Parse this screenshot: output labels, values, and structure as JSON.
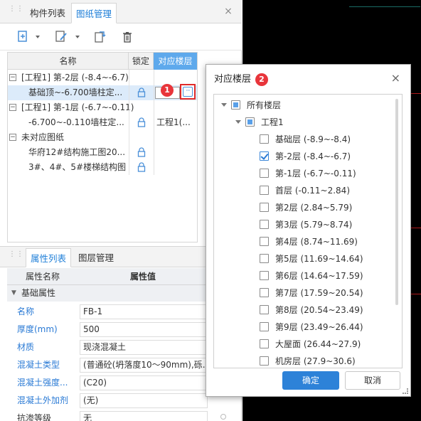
{
  "left_panel": {
    "tabs": [
      {
        "label": "构件列表",
        "active": false
      },
      {
        "label": "图纸管理",
        "active": true
      }
    ],
    "grid": {
      "columns": {
        "name": "名称",
        "lock": "锁定",
        "floor": "对应楼层"
      },
      "rows": [
        {
          "type": "group",
          "expand": "−",
          "name": "[工程1] 第-2层 (-8.4~-6.7)"
        },
        {
          "type": "item",
          "name": "基础顶~-6.700墙柱定...",
          "floor": "",
          "selected": true
        },
        {
          "type": "group",
          "expand": "−",
          "name": "[工程1] 第-1层 (-6.7~-0.11)"
        },
        {
          "type": "item",
          "name": "-6.700~-0.110墙柱定...",
          "floor": "工程1(..."
        },
        {
          "type": "group",
          "expand": "−",
          "name": "未对应图纸"
        },
        {
          "type": "item",
          "name": "华府12#结构施工图20...",
          "floor": ""
        },
        {
          "type": "item",
          "name": "3#、4#、5#楼梯结构图",
          "floor": ""
        }
      ]
    },
    "badge1": "1",
    "more_button_label": "···"
  },
  "properties": {
    "tabs": [
      {
        "label": "属性列表",
        "active": true
      },
      {
        "label": "图层管理",
        "active": false
      }
    ],
    "columns": {
      "name": "属性名称",
      "value": "属性值"
    },
    "group": "基础属性",
    "rows": [
      {
        "name": "名称",
        "value": "FB-1"
      },
      {
        "name": "厚度(mm)",
        "value": "500"
      },
      {
        "name": "材质",
        "value": "现浇混凝土"
      },
      {
        "name": "混凝土类型",
        "value": "(普通砼(坍落度10～90mm),砾..."
      },
      {
        "name": "混凝土强度...",
        "value": "(C20)"
      },
      {
        "name": "混凝土外加剂",
        "value": "(无)"
      },
      {
        "name": "抗渗等级",
        "value": "无"
      }
    ]
  },
  "dialog": {
    "title": "对应楼层",
    "badge2": "2",
    "close": "×",
    "all_floors": "所有楼层",
    "project": "工程1",
    "floors": [
      {
        "label": "基础层 (-8.9~-8.4)",
        "checked": false
      },
      {
        "label": "第-2层 (-8.4~-6.7)",
        "checked": true
      },
      {
        "label": "第-1层 (-6.7~-0.11)",
        "checked": false
      },
      {
        "label": "首层 (-0.11~2.84)",
        "checked": false
      },
      {
        "label": "第2层 (2.84~5.79)",
        "checked": false
      },
      {
        "label": "第3层 (5.79~8.74)",
        "checked": false
      },
      {
        "label": "第4层 (8.74~11.69)",
        "checked": false
      },
      {
        "label": "第5层 (11.69~14.64)",
        "checked": false
      },
      {
        "label": "第6层 (14.64~17.59)",
        "checked": false
      },
      {
        "label": "第7层 (17.59~20.54)",
        "checked": false
      },
      {
        "label": "第8层 (20.54~23.49)",
        "checked": false
      },
      {
        "label": "第9层 (23.49~26.44)",
        "checked": false
      },
      {
        "label": "大屋面 (26.44~27.9)",
        "checked": false
      },
      {
        "label": "机房层 (27.9~30.6)",
        "checked": false
      }
    ],
    "ok": "确定",
    "cancel": "取消"
  },
  "colors": {
    "accent": "#2d82d8",
    "badge": "#e8353b",
    "header_highlight": "#5ea9ec",
    "canvas": "#000000"
  }
}
